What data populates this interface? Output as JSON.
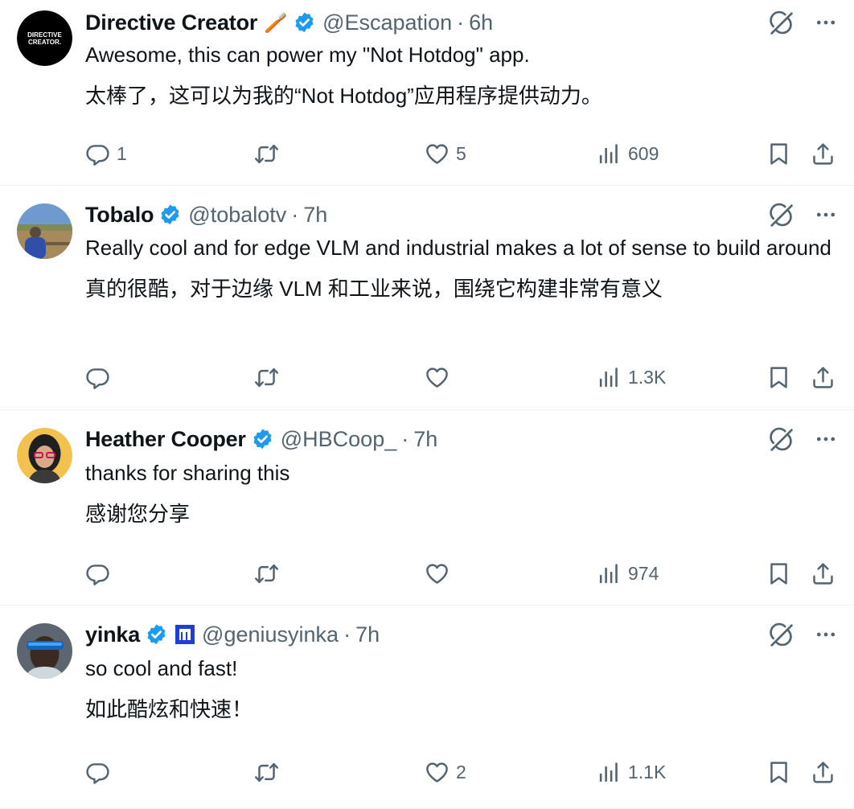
{
  "tweets": [
    {
      "name": "Directive Creator",
      "emoji": "🪥",
      "handle": "@Escapation",
      "separator": "·",
      "time": "6h",
      "text": "Awesome, this can power my \"Not Hotdog\" app.",
      "translation": "太棒了，这可以为我的“Not Hotdog”应用程序提供动力。",
      "avatar_text": [
        "DIRECTIVE",
        "CREATOR."
      ],
      "replies": "1",
      "retweets": "",
      "likes": "5",
      "views": "609"
    },
    {
      "name": "Tobalo",
      "handle": "@tobalotv",
      "separator": "·",
      "time": "7h",
      "text": "Really cool and for edge VLM and industrial makes a lot of sense to build around",
      "translation": "真的很酷，对于边缘 VLM 和工业来说，围绕它构建非常有意义",
      "replies": "",
      "retweets": "",
      "likes": "",
      "views": "1.3K"
    },
    {
      "name": "Heather Cooper",
      "handle": "@HBCoop_",
      "separator": "·",
      "time": "7h",
      "text": "thanks for sharing this",
      "translation": "感谢您分享",
      "replies": "",
      "retweets": "",
      "likes": "",
      "views": "974"
    },
    {
      "name": "yinka",
      "handle": "@geniusyinka",
      "separator": "·",
      "time": "7h",
      "text": "so cool and fast!",
      "translation": "如此酷炫和快速！",
      "replies": "",
      "retweets": "",
      "likes": "2",
      "views": "1.1K"
    }
  ],
  "colors": {
    "verified_blue": "#1d9bf0",
    "icon_gray": "#536471",
    "affiliate_blue": "#1d3fd8",
    "divider": "#eff3f4"
  },
  "icons": {
    "reply": "reply-icon",
    "retweet": "retweet-icon",
    "like": "like-icon",
    "views": "views-icon",
    "bookmark": "bookmark-icon",
    "share": "share-icon",
    "grok": "grok-icon",
    "more": "more-icon",
    "verified": "verified-badge-icon"
  }
}
